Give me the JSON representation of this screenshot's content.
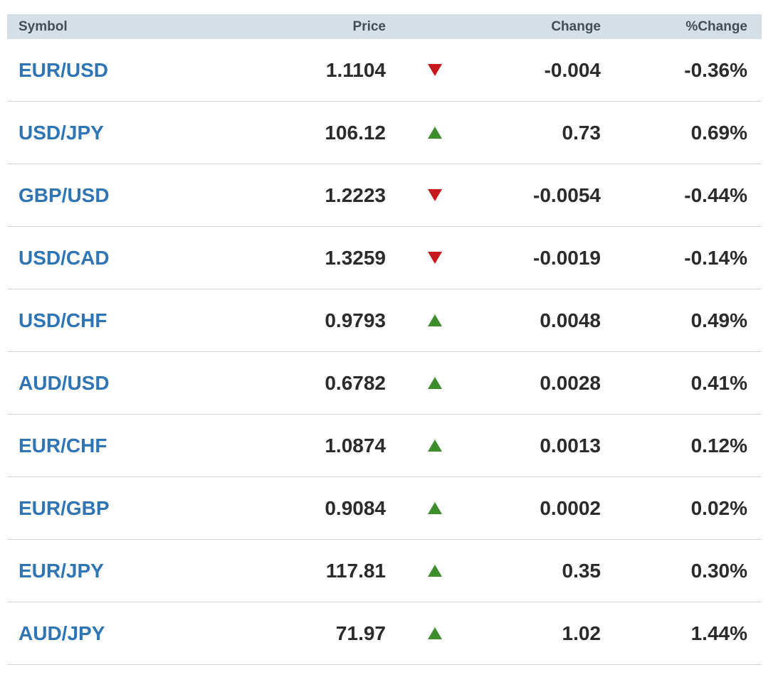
{
  "headers": {
    "symbol": "Symbol",
    "price": "Price",
    "change": "Change",
    "pct_change": "%Change"
  },
  "colors": {
    "header_bg": "#d4dfe8",
    "symbol_link": "#2f74b5",
    "down": "#c8161d",
    "up": "#3e8e2e"
  },
  "rows": [
    {
      "symbol": "EUR/USD",
      "price": "1.1104",
      "direction": "down",
      "icon": "triangle-down-icon",
      "change": "-0.004",
      "pct_change": "-0.36%"
    },
    {
      "symbol": "USD/JPY",
      "price": "106.12",
      "direction": "up",
      "icon": "triangle-up-icon",
      "change": "0.73",
      "pct_change": "0.69%"
    },
    {
      "symbol": "GBP/USD",
      "price": "1.2223",
      "direction": "down",
      "icon": "triangle-down-icon",
      "change": "-0.0054",
      "pct_change": "-0.44%"
    },
    {
      "symbol": "USD/CAD",
      "price": "1.3259",
      "direction": "down",
      "icon": "triangle-down-icon",
      "change": "-0.0019",
      "pct_change": "-0.14%"
    },
    {
      "symbol": "USD/CHF",
      "price": "0.9793",
      "direction": "up",
      "icon": "triangle-up-icon",
      "change": "0.0048",
      "pct_change": "0.49%"
    },
    {
      "symbol": "AUD/USD",
      "price": "0.6782",
      "direction": "up",
      "icon": "triangle-up-icon",
      "change": "0.0028",
      "pct_change": "0.41%"
    },
    {
      "symbol": "EUR/CHF",
      "price": "1.0874",
      "direction": "up",
      "icon": "triangle-up-icon",
      "change": "0.0013",
      "pct_change": "0.12%"
    },
    {
      "symbol": "EUR/GBP",
      "price": "0.9084",
      "direction": "up",
      "icon": "triangle-up-icon",
      "change": "0.0002",
      "pct_change": "0.02%"
    },
    {
      "symbol": "EUR/JPY",
      "price": "117.81",
      "direction": "up",
      "icon": "triangle-up-icon",
      "change": "0.35",
      "pct_change": "0.30%"
    },
    {
      "symbol": "AUD/JPY",
      "price": "71.97",
      "direction": "up",
      "icon": "triangle-up-icon",
      "change": "1.02",
      "pct_change": "1.44%"
    }
  ]
}
